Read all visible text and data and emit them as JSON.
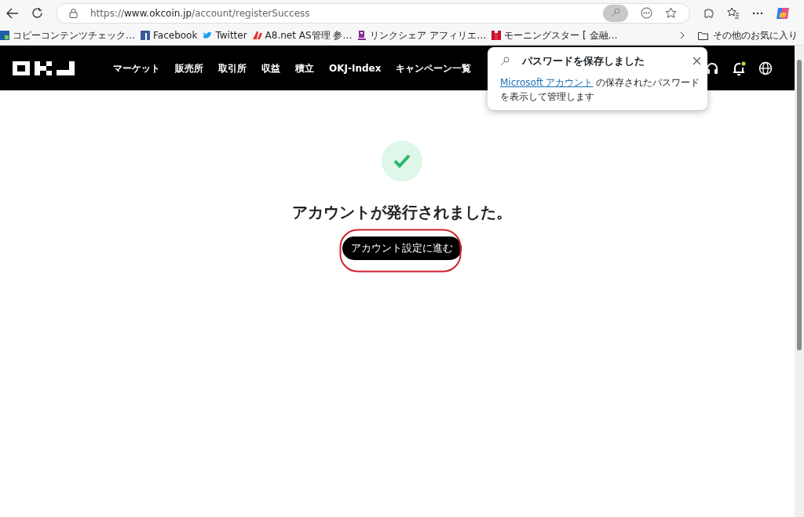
{
  "browser": {
    "url": "https://**www.okcoin.jp**/account/registerSuccess",
    "bookmarks": [
      {
        "label": "コピーコンテンツチェック…",
        "kind": "tile"
      },
      {
        "label": "Facebook",
        "kind": "square"
      },
      {
        "label": "Twitter",
        "kind": "bird"
      },
      {
        "label": "A8.net  AS管理  参…",
        "kind": "mark"
      },
      {
        "label": "リンクシェア  アフィリエ…",
        "kind": "letter"
      },
      {
        "label": "モーニングスター [ 金融…",
        "kind": "bars"
      }
    ],
    "other_favorites": "その他のお気に入り"
  },
  "site": {
    "nav": [
      {
        "label": "マーケット"
      },
      {
        "label": "販売所"
      },
      {
        "label": "取引所"
      },
      {
        "label": "収益"
      },
      {
        "label": "積立"
      },
      {
        "label": "OKJ-Index"
      },
      {
        "label": "キャンペーン一覧"
      }
    ],
    "notification_unread": true
  },
  "success": {
    "title": "アカウントが発行されました。",
    "button": "アカウント設定に進む",
    "highlighted": true
  },
  "popup": {
    "title": "パスワードを保存しました",
    "link": "Microsoft アカウント",
    "text": " の保存されたパスワードを表示して管理します"
  }
}
